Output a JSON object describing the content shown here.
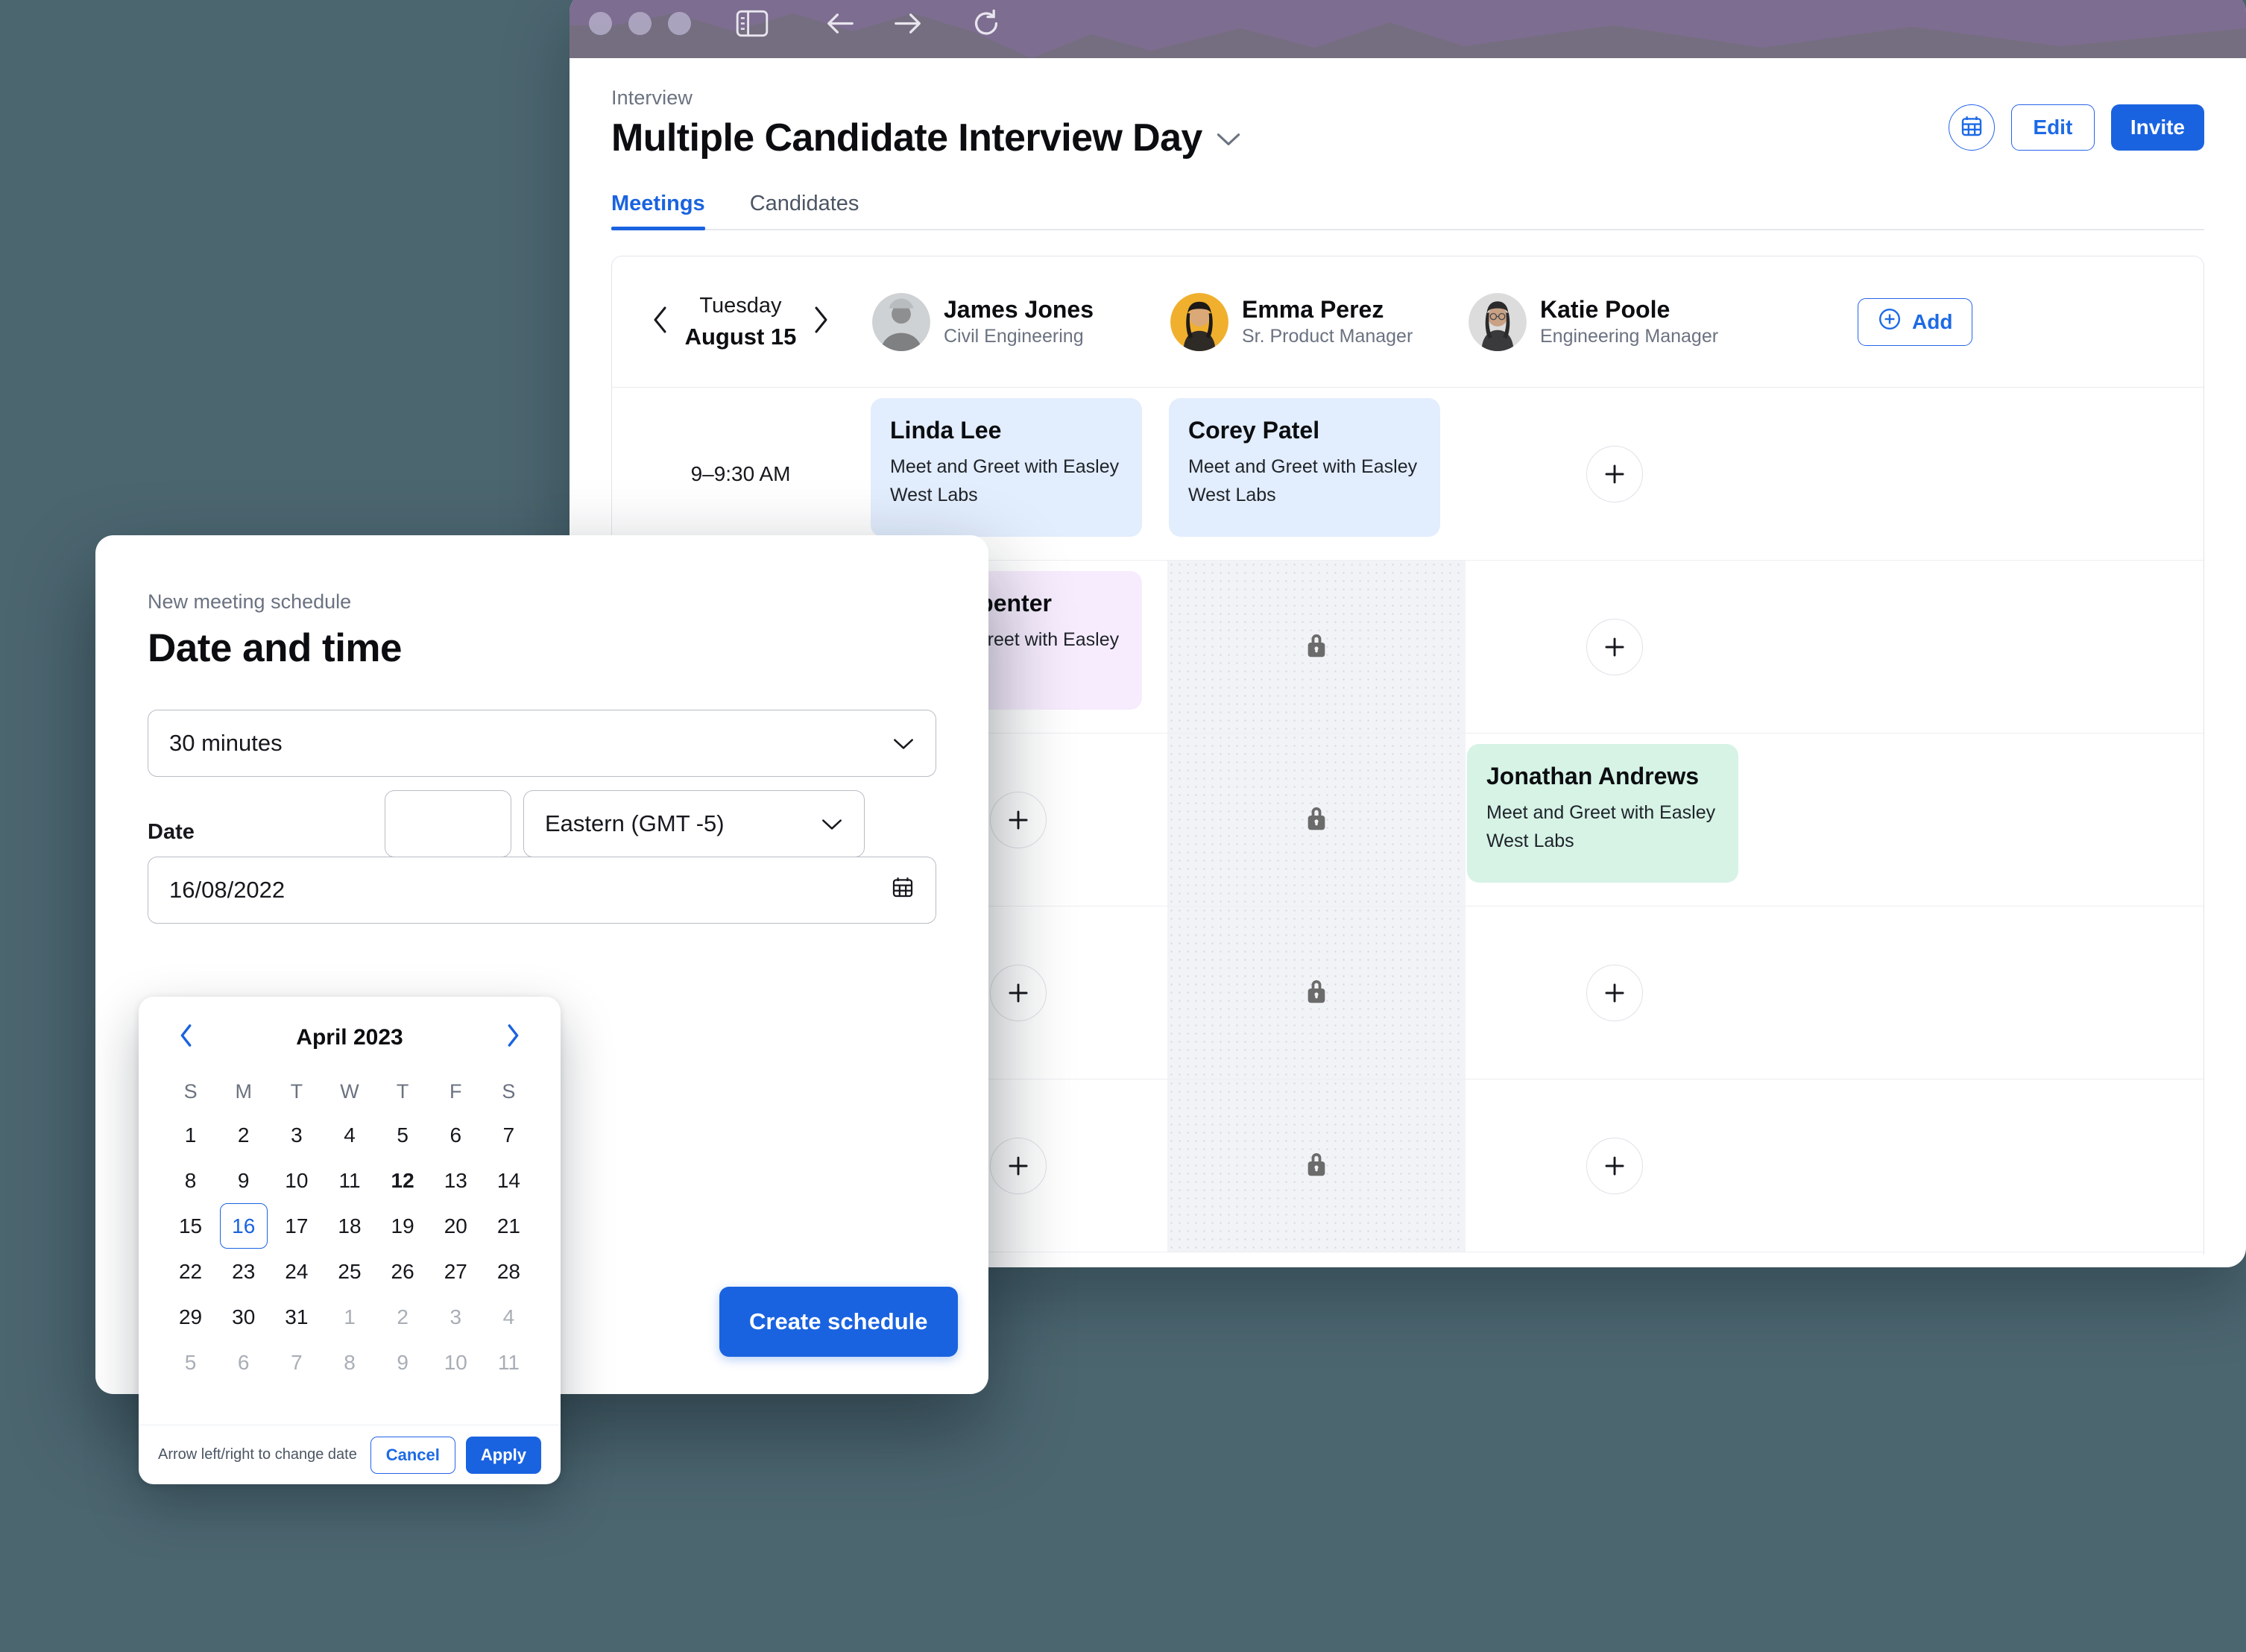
{
  "browser": {
    "traffic_dots": 3,
    "icons": [
      "sidebar-toggle-icon",
      "back-arrow-icon",
      "forward-arrow-icon",
      "reload-icon"
    ],
    "chrome_color": "#7d6d90"
  },
  "page": {
    "breadcrumb": "Interview",
    "title": "Multiple Candidate Interview Day",
    "accent_color": "#1a63e0"
  },
  "header_actions": {
    "calendar_icon": "calendar-icon",
    "edit_label": "Edit",
    "invite_label": "Invite"
  },
  "tabs": [
    {
      "label": "Meetings",
      "active": true
    },
    {
      "label": "Candidates",
      "active": false
    }
  ],
  "schedule": {
    "day": {
      "weekday": "Tuesday",
      "date": "August 15"
    },
    "prev_icon": "chevron-left-icon",
    "next_icon": "chevron-right-icon",
    "add_attendee_label": "Add",
    "attendees": [
      {
        "name": "James Jones",
        "role": "Civil Engineering",
        "avatar_color": "#d3d3d3"
      },
      {
        "name": "Emma Perez",
        "role": "Sr. Product Manager",
        "avatar_color": "#f0b02e"
      },
      {
        "name": "Katie Poole",
        "role": "Engineering Manager",
        "avatar_color": "#dcdcdc"
      }
    ],
    "rows": [
      {
        "time": "9–9:30 AM",
        "cells": [
          {
            "type": "meeting",
            "name": "Linda Lee",
            "desc": "Meet and Greet with Easley West Labs",
            "color": "blue"
          },
          {
            "type": "meeting",
            "name": "Corey Patel",
            "desc": "Meet and Greet with Easley West Labs",
            "color": "blue"
          },
          {
            "type": "empty"
          }
        ]
      },
      {
        "time": "",
        "cells": [
          {
            "type": "meeting",
            "name": "Jon Carpenter",
            "desc": "Meet and Greet with Easley West Labs",
            "color": "purple"
          },
          {
            "type": "locked"
          },
          {
            "type": "empty"
          }
        ]
      },
      {
        "time": "",
        "cells": [
          {
            "type": "empty"
          },
          {
            "type": "locked"
          },
          {
            "type": "meeting",
            "name": "Jonathan Andrews",
            "desc": "Meet and Greet with Easley West Labs",
            "color": "mint"
          }
        ]
      },
      {
        "time": "",
        "cells": [
          {
            "type": "empty"
          },
          {
            "type": "locked"
          },
          {
            "type": "empty"
          }
        ]
      },
      {
        "time": "",
        "cells": [
          {
            "type": "empty"
          },
          {
            "type": "locked"
          },
          {
            "type": "empty"
          }
        ]
      }
    ]
  },
  "modal": {
    "eyebrow": "New meeting schedule",
    "title": "Date and time",
    "duration": {
      "value": "30 minutes",
      "chevron": "chevron-down-icon"
    },
    "date": {
      "label": "Date",
      "value": "16/08/2022",
      "icon": "calendar-icon"
    },
    "timezone": {
      "value": "Eastern (GMT -5)",
      "chevron": "chevron-down-icon"
    },
    "submit_label": "Create schedule"
  },
  "datepicker": {
    "month": "April 2023",
    "prev_icon": "chevron-left-icon",
    "next_icon": "chevron-right-icon",
    "dow": [
      "S",
      "M",
      "T",
      "W",
      "T",
      "F",
      "S"
    ],
    "weeks": [
      [
        {
          "d": "1"
        },
        {
          "d": "2"
        },
        {
          "d": "3"
        },
        {
          "d": "4"
        },
        {
          "d": "5"
        },
        {
          "d": "6"
        },
        {
          "d": "7"
        }
      ],
      [
        {
          "d": "8"
        },
        {
          "d": "9"
        },
        {
          "d": "10"
        },
        {
          "d": "11"
        },
        {
          "d": "12",
          "today": true
        },
        {
          "d": "13"
        },
        {
          "d": "14"
        }
      ],
      [
        {
          "d": "15"
        },
        {
          "d": "16",
          "selected": true
        },
        {
          "d": "17"
        },
        {
          "d": "18"
        },
        {
          "d": "19"
        },
        {
          "d": "20"
        },
        {
          "d": "21"
        }
      ],
      [
        {
          "d": "22"
        },
        {
          "d": "23"
        },
        {
          "d": "24"
        },
        {
          "d": "25"
        },
        {
          "d": "26"
        },
        {
          "d": "27"
        },
        {
          "d": "28"
        }
      ],
      [
        {
          "d": "29"
        },
        {
          "d": "30"
        },
        {
          "d": "31"
        },
        {
          "d": "1",
          "muted": true
        },
        {
          "d": "2",
          "muted": true
        },
        {
          "d": "3",
          "muted": true
        },
        {
          "d": "4",
          "muted": true
        }
      ],
      [
        {
          "d": "5",
          "muted": true
        },
        {
          "d": "6",
          "muted": true
        },
        {
          "d": "7",
          "muted": true
        },
        {
          "d": "8",
          "muted": true
        },
        {
          "d": "9",
          "muted": true
        },
        {
          "d": "10",
          "muted": true
        },
        {
          "d": "11",
          "muted": true
        }
      ]
    ],
    "hint": "Arrow left/right to change date",
    "cancel_label": "Cancel",
    "apply_label": "Apply"
  }
}
